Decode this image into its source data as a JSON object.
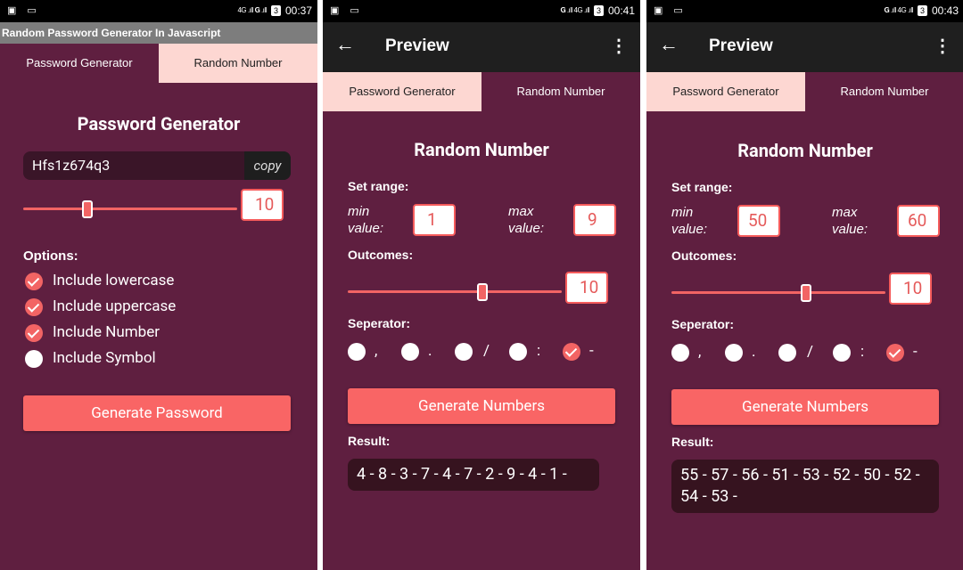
{
  "status_bars": [
    {
      "signal": "4G .ıll 𝐆 .ıll",
      "battery": "3",
      "time": "00:37"
    },
    {
      "signal": "𝐆 .ıll 4G .ıll",
      "battery": "3",
      "time": "00:41"
    },
    {
      "signal": "𝐆 .ıll 4G .ıll",
      "battery": "3",
      "time": "00:43"
    }
  ],
  "screen1": {
    "window_title": "Random Password Generator In Javascript",
    "tabs": [
      "Password Generator",
      "Random Number"
    ],
    "heading": "Password Generator",
    "password_value": "Hfs1z674q3",
    "copy_label": "copy",
    "length_value": "10",
    "length_fraction": 0.3,
    "options_label": "Options:",
    "options": [
      {
        "label": "Include lowercase",
        "checked": true
      },
      {
        "label": "Include uppercase",
        "checked": true
      },
      {
        "label": "Include Number",
        "checked": true
      },
      {
        "label": "Include Symbol",
        "checked": false
      }
    ],
    "generate_label": "Generate Password"
  },
  "screen2": {
    "appbar_title": "Preview",
    "tabs": [
      "Password Generator",
      "Random Number"
    ],
    "heading": "Random Number",
    "set_range_label": "Set range:",
    "min_label": "min value:",
    "max_label": "max value:",
    "min_value": "1",
    "max_value": "9",
    "outcomes_label": "Outcomes:",
    "outcomes_value": "10",
    "outcomes_fraction": 0.63,
    "separator_label": "Seperator:",
    "separators": [
      {
        "char": ",",
        "checked": false
      },
      {
        "char": ".",
        "checked": false
      },
      {
        "char": "/",
        "checked": false
      },
      {
        "char": ":",
        "checked": false
      },
      {
        "char": "-",
        "checked": true
      }
    ],
    "generate_label": "Generate Numbers",
    "result_label": "Result:",
    "result_value": "4 - 8 - 3 - 7 - 4 - 7 - 2 - 9 - 4 - 1 -"
  },
  "screen3": {
    "appbar_title": "Preview",
    "tabs": [
      "Password Generator",
      "Random Number"
    ],
    "heading": "Random Number",
    "set_range_label": "Set range:",
    "min_label": "min value:",
    "max_label": "max value:",
    "min_value": "50",
    "max_value": "60",
    "outcomes_label": "Outcomes:",
    "outcomes_value": "10",
    "outcomes_fraction": 0.63,
    "separator_label": "Seperator:",
    "separators": [
      {
        "char": ",",
        "checked": false
      },
      {
        "char": ".",
        "checked": false
      },
      {
        "char": "/",
        "checked": false
      },
      {
        "char": ":",
        "checked": false
      },
      {
        "char": "-",
        "checked": true
      }
    ],
    "generate_label": "Generate Numbers",
    "result_label": "Result:",
    "result_value": "55 - 57 - 56 - 51 - 53 - 52 - 50 - 52 - 54 - 53 -"
  },
  "colors": {
    "background": "#5f1f40",
    "accent": "#f96565",
    "tab_light": "#fdd7d2",
    "appbar": "#1f1f1f",
    "result_bg": "#36131f"
  }
}
